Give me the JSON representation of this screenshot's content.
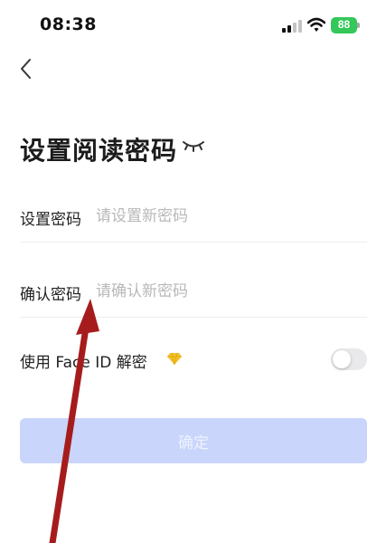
{
  "status_bar": {
    "time": "08:38",
    "battery_level": "88"
  },
  "page": {
    "title": "设置阅读密码"
  },
  "form": {
    "password": {
      "label": "设置密码",
      "placeholder": "请设置新密码",
      "value": ""
    },
    "confirm": {
      "label": "确认密码",
      "placeholder": "请确认新密码",
      "value": ""
    },
    "faceid": {
      "label": "使用 Face ID 解密",
      "enabled": false
    },
    "confirm_button": "确定"
  },
  "colors": {
    "button_disabled": "#c9d5fb",
    "battery": "#34c759",
    "annotation_arrow": "#a61c1c",
    "vip_badge": "#f2c12e"
  },
  "icons": [
    "signal-icon",
    "wifi-icon",
    "battery-icon",
    "back-arrow-icon",
    "eye-closed-icon",
    "vip-diamond-icon"
  ]
}
